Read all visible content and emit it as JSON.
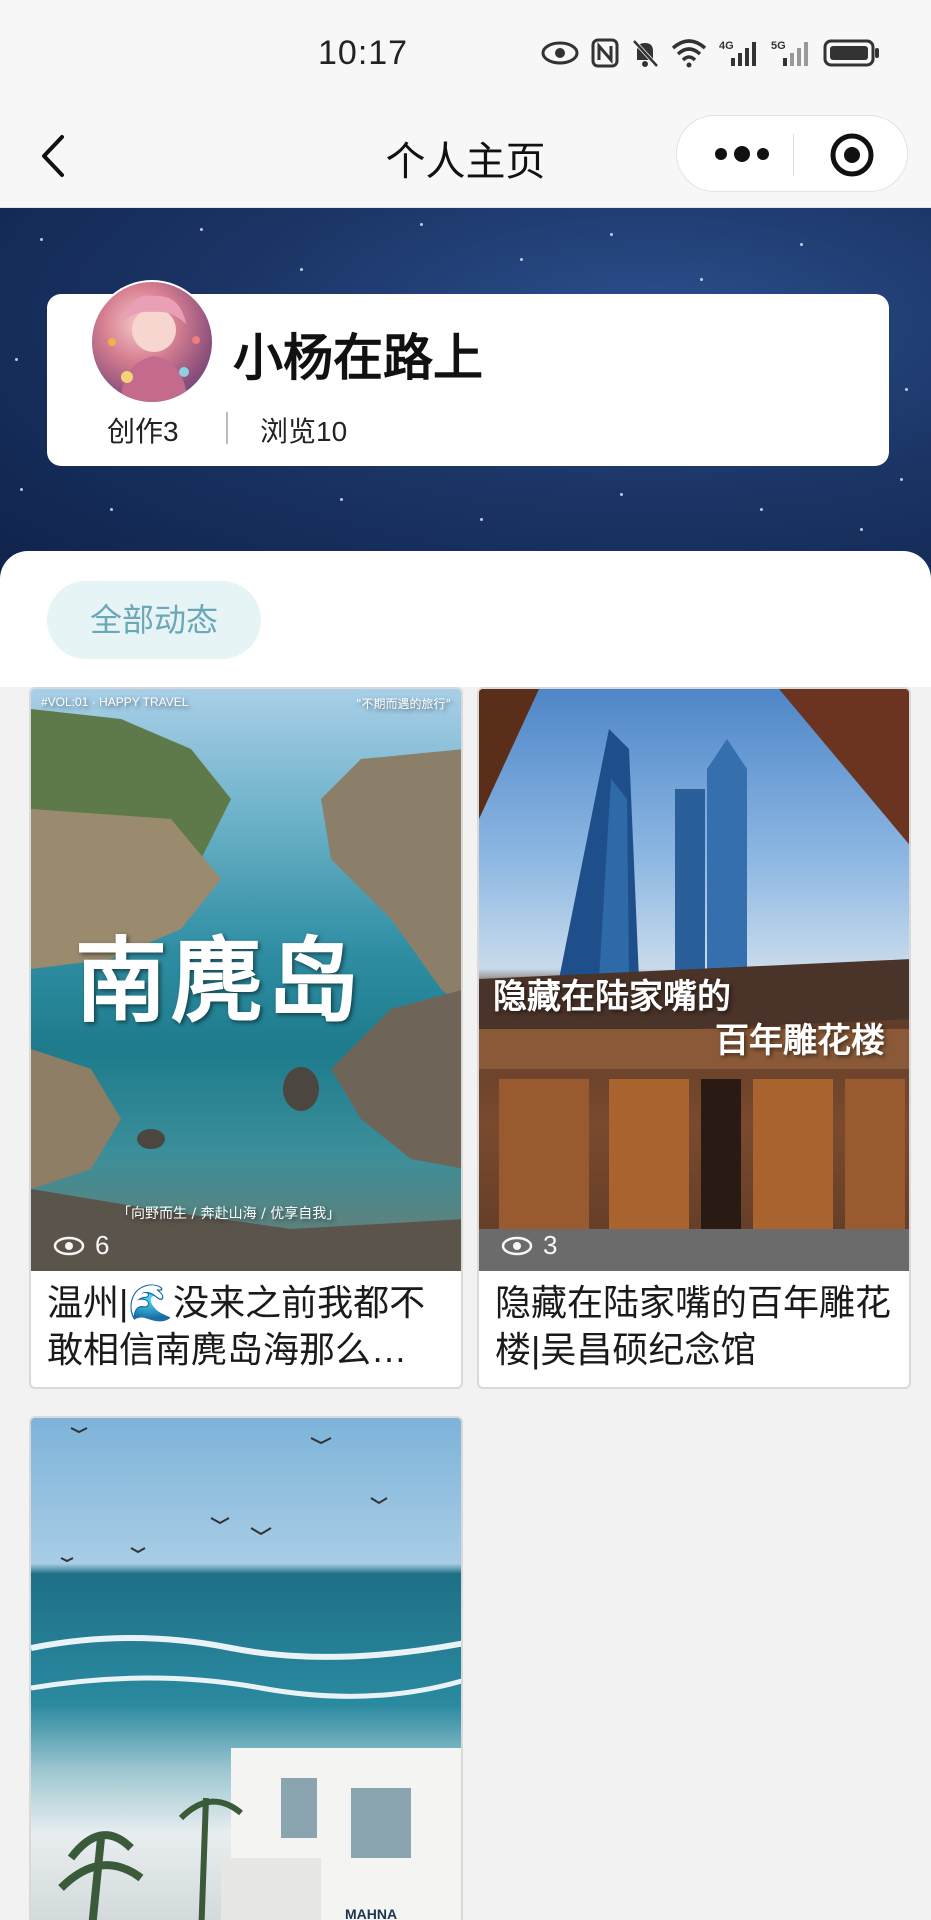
{
  "status_bar": {
    "time": "10:17",
    "net1": "4G",
    "net2": "5G"
  },
  "nav": {
    "title": "个人主页"
  },
  "profile": {
    "name": "小杨在路上",
    "works_label": "创作3",
    "views_label": "浏览10"
  },
  "filter": {
    "active_label": "全部动态"
  },
  "posts": [
    {
      "title": "温州|🌊没来之前我都不敢相信南麂岛海那么…",
      "views": "6",
      "image_text_main": "南麂岛",
      "image_text_top_left": "#VOL:01 · HAPPY TRAVEL",
      "image_text_top_right": "\"不期而遇的旅行\"",
      "image_text_bottom": "「向野而生 / 奔赴山海 / 优享自我」"
    },
    {
      "title": "隐藏在陆家嘴的百年雕花楼|吴昌硕纪念馆",
      "views": "3",
      "image_text_line1": "隐藏在陆家嘴的",
      "image_text_line2": "百年雕花楼"
    },
    {
      "title": "",
      "views": "",
      "image_text_sign": "MAHNA"
    }
  ],
  "colors": {
    "accent_pill_bg": "#e6f4f6",
    "accent_pill_text": "#6aa7b8",
    "hero_bg": "#1b3566"
  }
}
